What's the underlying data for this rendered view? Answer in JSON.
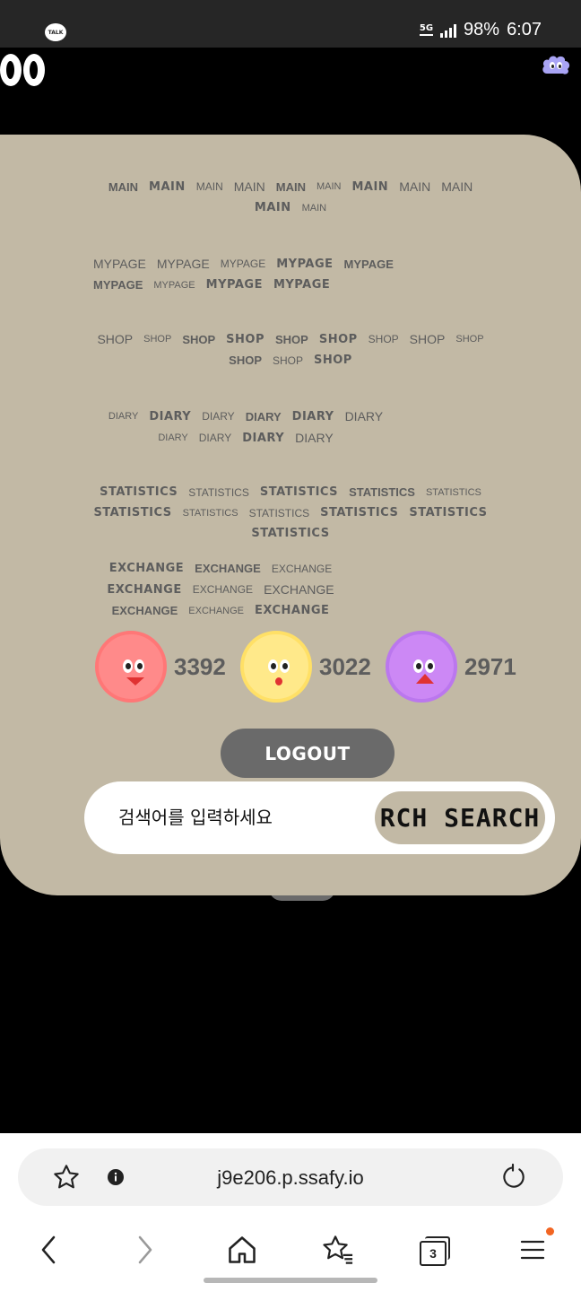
{
  "status_bar": {
    "app_badge": "TALK",
    "network": "5G",
    "battery": "98%",
    "time": "6:07"
  },
  "menu": {
    "main": [
      "MAIN",
      "MAIN",
      "MAIN",
      "MAIN",
      "MAIN",
      "MAIN",
      "MAIN",
      "MAIN",
      "MAIN",
      "MAIN",
      "MAIN"
    ],
    "mypage": [
      "MYPAGE",
      "MYPAGE",
      "MYPAGE",
      "MYPAGE",
      "MYPAGE",
      "MYPAGE",
      "MYPAGE",
      "MYPAGE",
      "MYPAGE"
    ],
    "shop": [
      "SHOP",
      "SHOP",
      "SHOP",
      "SHOP",
      "SHOP",
      "SHOP",
      "SHOP",
      "SHOP",
      "SHOP",
      "SHOP",
      "SHOP",
      "SHOP"
    ],
    "diary": [
      "DIARY",
      "DIARY",
      "DIARY",
      "DIARY",
      "DIARY",
      "DIARY",
      "DIARY",
      "DIARY",
      "DIARY",
      "DIARY"
    ],
    "statistics": [
      "STATISTICS",
      "STATISTICS",
      "STATISTICS",
      "STATISTICS",
      "STATISTICS",
      "STATISTICS",
      "STATISTICS",
      "STATISTICS",
      "STATISTICS",
      "STATISTICS",
      "STATISTICS"
    ],
    "exchange": [
      "EXCHANGE",
      "EXCHANGE",
      "EXCHANGE",
      "EXCHANGE",
      "EXCHANGE",
      "EXCHANGE",
      "EXCHANGE",
      "EXCHANGE",
      "EXCHANGE"
    ]
  },
  "scores": [
    {
      "value": "3392",
      "color": "#ff8a8a",
      "ring": "#ff7777",
      "face": "red-character"
    },
    {
      "value": "3022",
      "color": "#ffe98a",
      "ring": "#ffe066",
      "face": "yellow-character"
    },
    {
      "value": "2971",
      "color": "#cc88f5",
      "ring": "#bb77ee",
      "face": "purple-character"
    }
  ],
  "logout_label": "LOGOUT",
  "search": {
    "placeholder": "검색어를 입력하세요",
    "button_label": "RCH SEARCH"
  },
  "browser": {
    "url": "j9e206.p.ssafy.io",
    "tab_count": "3"
  },
  "colors": {
    "card_bg": "#c2b9a5",
    "menu_text": "#5d5d5d",
    "logout_bg": "#6a6a6a",
    "notification_dot": "#f26522"
  }
}
